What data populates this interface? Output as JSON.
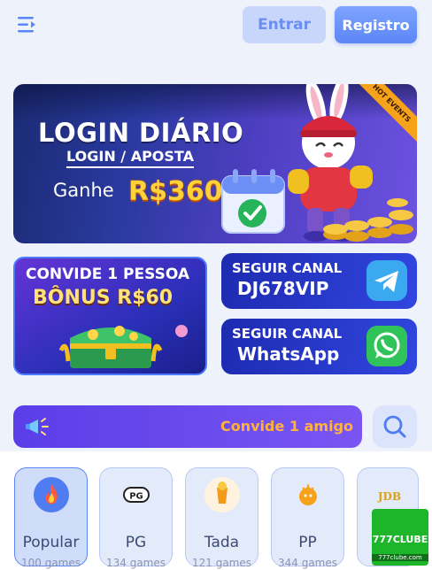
{
  "header": {
    "login_label": "Entrar",
    "register_label": "Registro",
    "colors": {
      "primary": "#5b86f5",
      "login_bg": "#c9d6fb"
    }
  },
  "hero": {
    "title": "LOGIN DIÁRIO",
    "subtitle": "LOGIN / APOSTA",
    "gain_label": "Ganhe",
    "amount": "R$360",
    "ribbon": "HOT EVENTS"
  },
  "promos": {
    "invite": {
      "line1": "CONVIDE 1 PESSOA",
      "line2": "BÔNUS R$60"
    },
    "telegram": {
      "line1": "SEGUIR CANAL",
      "line2": "DJ678VIP",
      "icon": "telegram-icon"
    },
    "whatsapp": {
      "line1": "SEGUIR CANAL",
      "line2": "WhatsApp",
      "icon": "whatsapp-icon"
    }
  },
  "marquee": {
    "text": "Convide 1 amigo"
  },
  "categories": [
    {
      "name": "Popular",
      "count": "100 games",
      "icon": "fire-icon",
      "active": true
    },
    {
      "name": "PG",
      "count": "134 games",
      "icon": "pg-icon",
      "active": false
    },
    {
      "name": "Tada",
      "count": "121 games",
      "icon": "tada-icon",
      "active": false
    },
    {
      "name": "PP",
      "count": "344 games",
      "icon": "pp-icon",
      "active": false
    },
    {
      "name": "",
      "count": "",
      "icon": "jdb-icon",
      "active": false
    }
  ],
  "watermark": {
    "title": "777CLUBE",
    "domain": "777clube.com"
  }
}
